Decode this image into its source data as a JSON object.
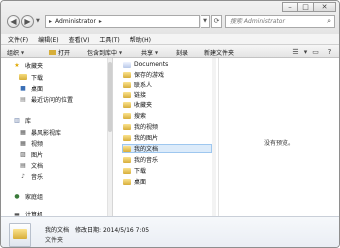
{
  "titlebar": {
    "breadcrumb": [
      "Administrator"
    ],
    "search_placeholder": "搜索 Administrator"
  },
  "menu": [
    "文件(F)",
    "编辑(E)",
    "查看(V)",
    "工具(T)",
    "帮助(H)"
  ],
  "toolbar": {
    "organize": "组织",
    "open": "打开",
    "include_in_library": "包含到库中",
    "share": "共享",
    "burn": "刻录",
    "new_folder": "新建文件夹"
  },
  "nav": {
    "favorites": "收藏夹",
    "downloads": "下载",
    "desktop": "桌面",
    "recent": "最近访问的位置",
    "libraries": "库",
    "videos_lib": "暴风影视库",
    "video": "视频",
    "pictures": "图片",
    "documents": "文档",
    "music": "音乐",
    "homegroup": "家庭组",
    "computer": "计算机"
  },
  "files": [
    {
      "name": "Documents",
      "selected": false
    },
    {
      "name": "保存的游戏",
      "selected": false
    },
    {
      "name": "联系人",
      "selected": false
    },
    {
      "name": "链接",
      "selected": false
    },
    {
      "name": "收藏夹",
      "selected": false
    },
    {
      "name": "搜索",
      "selected": false
    },
    {
      "name": "我的视频",
      "selected": false
    },
    {
      "name": "我的图片",
      "selected": false
    },
    {
      "name": "我的文档",
      "selected": true
    },
    {
      "name": "我的音乐",
      "selected": false
    },
    {
      "name": "下载",
      "selected": false
    },
    {
      "name": "桌面",
      "selected": false
    }
  ],
  "preview": {
    "empty_text": "没有预览。"
  },
  "details": {
    "name": "我的文档",
    "modified": "修改日期: 2014/5/16 7:05",
    "type": "文件夹"
  }
}
